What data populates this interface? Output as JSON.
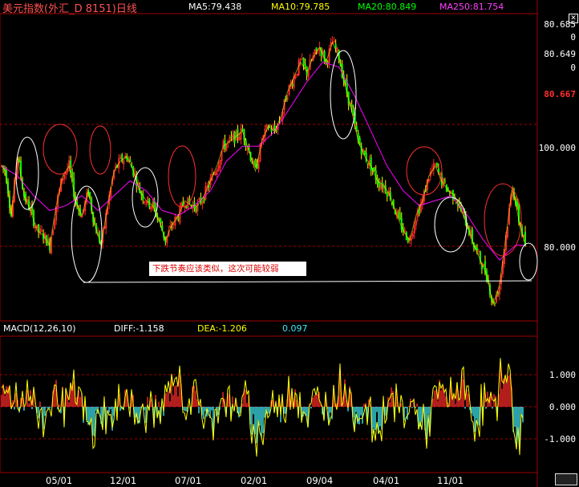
{
  "header": {
    "title": "美元指数(外汇_D 8151)日线",
    "ma5": "MA5:79.438",
    "ma10": "MA10:79.785",
    "ma20": "MA20:80.849",
    "ma250": "MA250:81.754"
  },
  "right_axis": {
    "labels": [
      "80.685",
      "0",
      "80.649",
      "0",
      "100.000",
      "80.000"
    ],
    "current_price": "80.667"
  },
  "annotation": "下跌节奏应该类似，这次可能较弱",
  "macd_header": {
    "name": "MACD(12,26,10)",
    "diff": "DIFF:-1.158",
    "dea": "DEA:-1.206",
    "macd": "0.097"
  },
  "macd_axis": [
    "1.000",
    "0.000",
    "-1.000"
  ],
  "x_labels": [
    "05/01",
    "12/01",
    "07/01",
    "02/01",
    "09/04",
    "04/01",
    "11/01"
  ],
  "colors": {
    "up": "#ff2a2a",
    "down": "#40e8f0",
    "ma5": "#ffffff",
    "ma10": "#ffff00",
    "ma20": "#00ff00",
    "ma250": "#ff00ff",
    "grid": "#a00000",
    "circle_red": "#ff3030",
    "circle_white": "#ffffff"
  },
  "chart_data": [
    {
      "type": "line",
      "title": "美元指数(外汇_D 8151)日线",
      "y_tick_labels": [
        "100.000",
        "80.000"
      ],
      "x": [
        "05/01",
        "12/01",
        "07/01",
        "02/01",
        "09/04",
        "04/01",
        "11/01"
      ],
      "series": [
        {
          "name": "MA5:79.438",
          "color": "#ffff00"
        },
        {
          "name": "MA20:80.849",
          "color": "#ff00ff"
        }
      ],
      "price_path": [
        [
          0,
          96
        ],
        [
          5,
          95
        ],
        [
          12,
          86
        ],
        [
          20,
          98
        ],
        [
          28,
          90
        ],
        [
          36,
          87
        ],
        [
          44,
          83
        ],
        [
          52,
          82
        ],
        [
          60,
          80
        ],
        [
          68,
          88
        ],
        [
          76,
          94
        ],
        [
          84,
          96
        ],
        [
          92,
          89
        ],
        [
          100,
          86
        ],
        [
          108,
          91
        ],
        [
          116,
          84
        ],
        [
          124,
          80
        ],
        [
          132,
          88
        ],
        [
          140,
          95
        ],
        [
          148,
          97
        ],
        [
          156,
          98
        ],
        [
          164,
          95
        ],
        [
          172,
          91
        ],
        [
          180,
          89
        ],
        [
          188,
          88
        ],
        [
          196,
          85
        ],
        [
          204,
          81
        ],
        [
          212,
          84
        ],
        [
          220,
          86
        ],
        [
          228,
          89
        ],
        [
          236,
          88
        ],
        [
          244,
          88
        ],
        [
          252,
          90
        ],
        [
          260,
          93
        ],
        [
          268,
          96
        ],
        [
          276,
          100
        ],
        [
          284,
          101
        ],
        [
          292,
          102
        ],
        [
          300,
          103
        ],
        [
          308,
          99
        ],
        [
          316,
          95
        ],
        [
          324,
          101
        ],
        [
          332,
          104
        ],
        [
          340,
          103
        ],
        [
          348,
          106
        ],
        [
          356,
          111
        ],
        [
          364,
          114
        ],
        [
          372,
          117
        ],
        [
          380,
          115
        ],
        [
          388,
          118
        ],
        [
          396,
          120
        ],
        [
          404,
          117
        ],
        [
          412,
          121
        ],
        [
          420,
          118
        ],
        [
          428,
          112
        ],
        [
          436,
          107
        ],
        [
          444,
          101
        ],
        [
          452,
          98
        ],
        [
          460,
          96
        ],
        [
          468,
          93
        ],
        [
          476,
          92
        ],
        [
          484,
          90
        ],
        [
          492,
          86
        ],
        [
          500,
          83
        ],
        [
          508,
          81
        ],
        [
          516,
          86
        ],
        [
          524,
          89
        ],
        [
          532,
          94
        ],
        [
          540,
          96
        ],
        [
          548,
          93
        ],
        [
          556,
          91
        ],
        [
          564,
          90
        ],
        [
          572,
          87
        ],
        [
          580,
          84
        ],
        [
          588,
          80
        ],
        [
          596,
          77
        ],
        [
          604,
          74
        ],
        [
          612,
          68
        ],
        [
          620,
          72
        ],
        [
          628,
          82
        ],
        [
          636,
          92
        ],
        [
          644,
          85
        ],
        [
          652,
          80
        ]
      ],
      "ma_path": [
        [
          0,
          96
        ],
        [
          20,
          94
        ],
        [
          40,
          90
        ],
        [
          60,
          87
        ],
        [
          80,
          88
        ],
        [
          100,
          90
        ],
        [
          120,
          87
        ],
        [
          140,
          90
        ],
        [
          160,
          93
        ],
        [
          180,
          91
        ],
        [
          200,
          87
        ],
        [
          220,
          86
        ],
        [
          240,
          88
        ],
        [
          260,
          91
        ],
        [
          280,
          97
        ],
        [
          300,
          100
        ],
        [
          320,
          100
        ],
        [
          340,
          103
        ],
        [
          360,
          108
        ],
        [
          380,
          113
        ],
        [
          400,
          117
        ],
        [
          420,
          116
        ],
        [
          440,
          110
        ],
        [
          460,
          103
        ],
        [
          480,
          96
        ],
        [
          500,
          91
        ],
        [
          520,
          88
        ],
        [
          540,
          89
        ],
        [
          560,
          90
        ],
        [
          580,
          86
        ],
        [
          600,
          81
        ],
        [
          620,
          77
        ],
        [
          640,
          80
        ],
        [
          652,
          80
        ]
      ],
      "ylim": [
        66,
        125
      ]
    },
    {
      "type": "bar",
      "title": "MACD(12,26,10)",
      "y_tick_labels": [
        "1.000",
        "0.000",
        "-1.000"
      ],
      "x": [
        "05/01",
        "12/01",
        "07/01",
        "02/01",
        "09/04",
        "04/01",
        "11/01"
      ],
      "ylim": [
        -2,
        2
      ],
      "series": [
        {
          "name": "DIFF:-1.158",
          "color": "#ffff00"
        },
        {
          "name": "DEA:-1.206",
          "color": "#ffffff"
        }
      ]
    }
  ]
}
